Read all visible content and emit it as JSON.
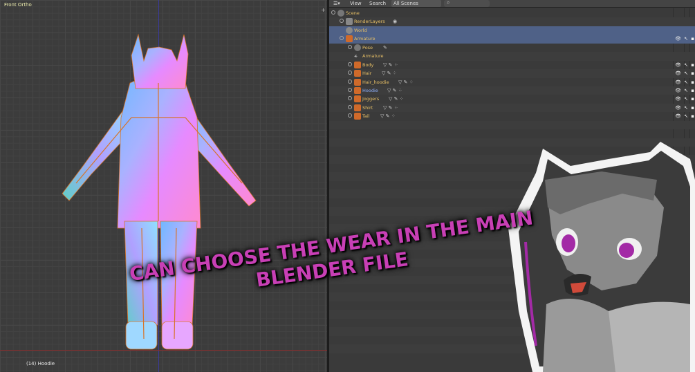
{
  "viewport": {
    "view_name": "Front Ortho",
    "active_object": "(14) Hoodie"
  },
  "outliner": {
    "header": {
      "view": "View",
      "search": "Search",
      "scenes": "All Scenes"
    },
    "items": [
      {
        "label": "Scene",
        "color": "#e8c066"
      },
      {
        "label": "RenderLayers",
        "color": "#e8c066"
      },
      {
        "label": "World",
        "color": "#e8c066"
      },
      {
        "label": "Armature",
        "color": "#e8c066"
      },
      {
        "label": "Pose",
        "color": "#e8c066"
      },
      {
        "label": "Armature",
        "color": "#e8c066"
      },
      {
        "label": "Body",
        "color": "#e8c066"
      },
      {
        "label": "Hair",
        "color": "#e8c066"
      },
      {
        "label": "Hair_hoodie",
        "color": "#e8c066"
      },
      {
        "label": "Hoodie",
        "color": "#8fb2ff"
      },
      {
        "label": "Joggers",
        "color": "#e8c066"
      },
      {
        "label": "Shirt",
        "color": "#e8c066"
      },
      {
        "label": "Tail",
        "color": "#e8c066"
      }
    ]
  },
  "caption": {
    "line1": "CAN CHOOSE THE WEAR IN THE MAIN",
    "line2": "BLENDER FILE"
  },
  "colors": {
    "accent_magenta": "#c83fb5",
    "selection": "#4f6187",
    "label_yellow": "#e8c066",
    "label_blue": "#8fb2ff"
  }
}
